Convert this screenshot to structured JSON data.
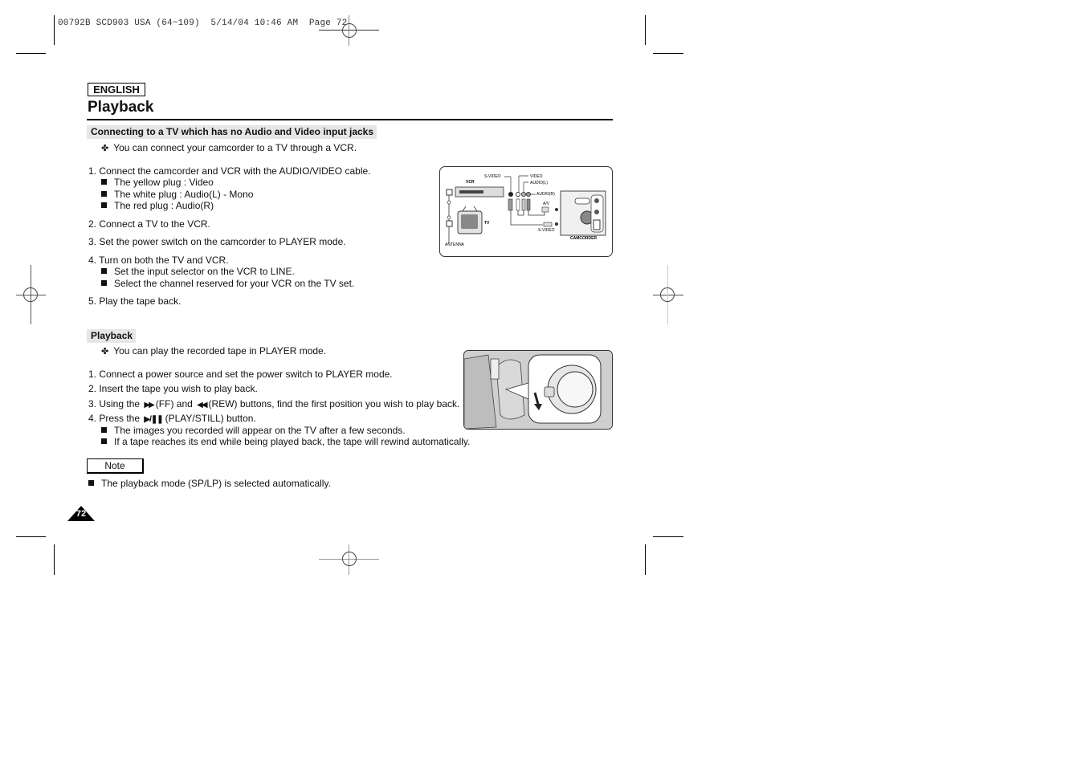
{
  "slug": "00792B SCD903 USA (64~109)  5/14/04 10:46 AM  Page 72",
  "header": {
    "language": "ENGLISH",
    "title": "Playback"
  },
  "section1": {
    "heading": "Connecting to a TV which has no Audio and Video input jacks",
    "intro": "You can connect your camcorder to a TV through a VCR.",
    "steps": [
      {
        "text": "1.  Connect the camcorder and VCR with the AUDIO/VIDEO cable.",
        "bullets": [
          "The yellow plug :  Video",
          "The white plug :  Audio(L) - Mono",
          "The red plug :  Audio(R)"
        ]
      },
      {
        "text": "2.  Connect a TV to the VCR.",
        "bullets": []
      },
      {
        "text": "3.  Set the power switch on the camcorder to PLAYER mode.",
        "bullets": []
      },
      {
        "text": "4.  Turn on both the TV and VCR.",
        "bullets": [
          "Set the input selector on the VCR to LINE.",
          "Select the channel reserved for your VCR on the TV set."
        ]
      },
      {
        "text": "5.  Play the tape back.",
        "bullets": []
      }
    ],
    "diagram_labels": {
      "s_video_top": "S-VIDEO",
      "video": "VIDEO",
      "audio_l": "AUDIO(L)",
      "audio_r": "AUDIO(R)",
      "vcr": "VCR",
      "tv": "TV",
      "av": "A/V",
      "s_video_bottom": "S-VIDEO",
      "antenna": "ANTENNA",
      "camcorder": "CAMCORDER"
    }
  },
  "section2": {
    "heading": "Playback",
    "intro": "You can play the recorded tape in PLAYER mode.",
    "step1": "1.  Connect a power source and set the power switch to PLAYER mode.",
    "step2": "2.  Insert the tape you wish to play back.",
    "step3_pre": "3.  Using the",
    "step3_ff_glyph": "▶▶",
    "step3_mid": "(FF) and",
    "step3_rew_glyph": "◀◀",
    "step3_post": "(REW) buttons, find the first position you wish to play back.",
    "step4_pre": "4.  Press the",
    "step4_glyph": "▶/❚❚",
    "step4_post": "(PLAY/STILL) button.",
    "step4_bullets": [
      "The images you recorded will appear on the TV after a few seconds.",
      "If a tape reaches its end while being played back, the tape will rewind automatically."
    ]
  },
  "note": {
    "label": "Note",
    "text": "The playback mode (SP/LP) is selected automatically."
  },
  "page_number": "72"
}
